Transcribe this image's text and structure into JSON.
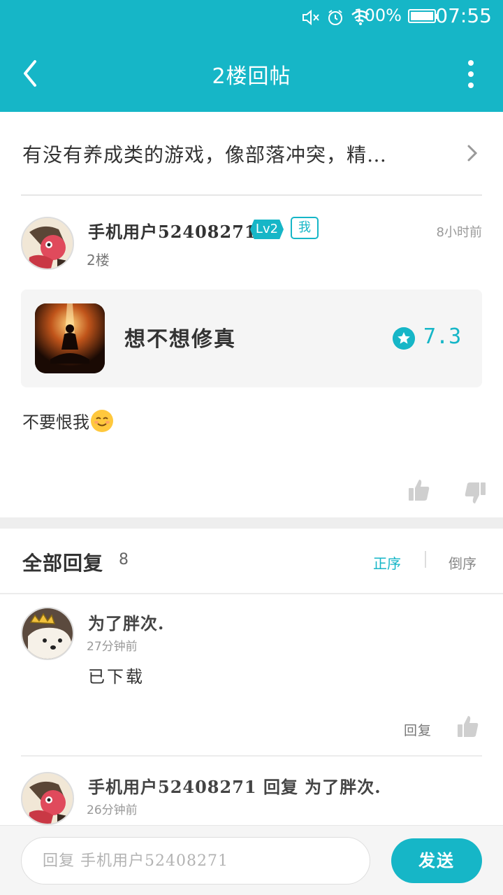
{
  "status_bar": {
    "battery_percent": "100%",
    "battery_level": 1.0,
    "time": "07:55",
    "icons": [
      "mute-icon",
      "alarm-icon",
      "wifi-icon",
      "battery-icon"
    ]
  },
  "nav": {
    "title": "2楼回帖",
    "back_icon": "back-arrow-icon",
    "more_icon": "more-vertical-icon"
  },
  "thread": {
    "title": "有没有养成类的游戏，像部落冲突，精…"
  },
  "post": {
    "username": "手机用户52408271",
    "level": "Lv2",
    "me_badge": "我",
    "time": "8小时前",
    "floor": "2楼",
    "game": {
      "name": "想不想修真",
      "score": "7.3"
    },
    "content": "不要恨我"
  },
  "replies": {
    "title": "全部回复",
    "count": "8",
    "sort_asc": "正序",
    "sort_desc": "倒序",
    "items": [
      {
        "name": "为了胖次.",
        "time": "27分钟前",
        "text": "已下载",
        "reply_label": "回复"
      },
      {
        "name": "手机用户52408271 回复 为了胖次.",
        "time": "26分钟前"
      }
    ]
  },
  "bottom": {
    "input_placeholder": "回复 手机用户52408271",
    "send_label": "发送"
  },
  "colors": {
    "accent": "#16b6c7",
    "background": "#ffffff",
    "separator": "#eeeeee"
  }
}
